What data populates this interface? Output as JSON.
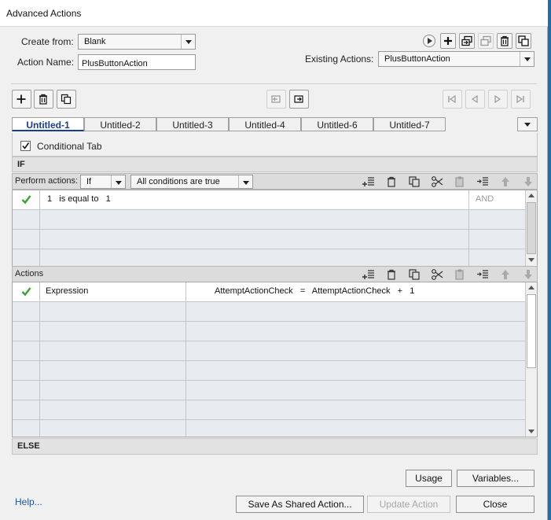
{
  "window": {
    "title": "Advanced Actions"
  },
  "create_from": {
    "label": "Create from:",
    "value": "Blank"
  },
  "action_name": {
    "label": "Action Name:",
    "value": "PlusButtonAction"
  },
  "existing_actions": {
    "label": "Existing Actions:",
    "value": "PlusButtonAction"
  },
  "tabs": [
    "Untitled-1",
    "Untitled-2",
    "Untitled-3",
    "Untitled-4",
    "Untitled-6",
    "Untitled-7"
  ],
  "conditional_tab": {
    "label": "Conditional Tab",
    "checked": true
  },
  "if_section": {
    "header": "IF",
    "perform_label": "Perform actions:",
    "perform_value": "If",
    "conditions_value": "All conditions are true",
    "rows": [
      {
        "cond": "1   is equal to   1",
        "op": "AND"
      }
    ]
  },
  "actions_section": {
    "header": "Actions",
    "rows": [
      {
        "type": "Expression",
        "detail": "AttemptActionCheck   =   AttemptActionCheck   +   1"
      }
    ]
  },
  "else_section": {
    "header": "ELSE"
  },
  "footer": {
    "help": "Help...",
    "usage": "Usage",
    "variables": "Variables...",
    "save_shared": "Save As Shared Action...",
    "update": "Update Action",
    "close": "Close"
  },
  "colors": {
    "accent": "#1a3d8f",
    "check": "#3aa52c",
    "link": "#1a56a8"
  }
}
